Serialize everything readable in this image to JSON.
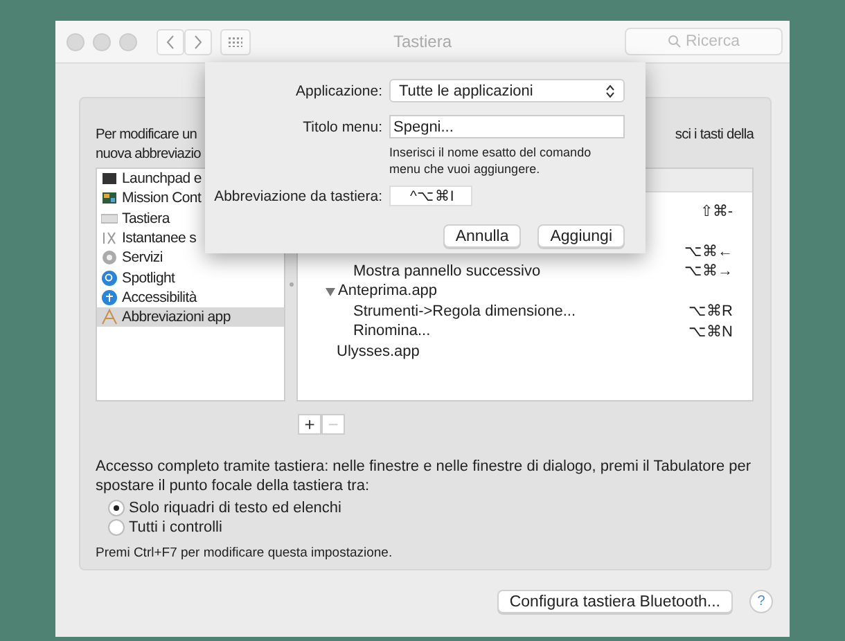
{
  "window": {
    "title": "Tastiera",
    "search": {
      "placeholder": "Ricerca"
    }
  },
  "intro": {
    "left_lines": [
      "Per modificare un",
      "nuova abbreviazio"
    ],
    "right_fragment": "sci i tasti della"
  },
  "sidebar": {
    "items": [
      {
        "label": "Launchpad e",
        "selected": false
      },
      {
        "label": "Mission Cont",
        "selected": false
      },
      {
        "label": "Tastiera",
        "selected": false
      },
      {
        "label": "Istantanee s",
        "selected": false
      },
      {
        "label": "Servizi",
        "selected": false
      },
      {
        "label": "Spotlight",
        "selected": false
      },
      {
        "label": "Accessibilità",
        "selected": false
      },
      {
        "label": "Abbreviazioni app",
        "selected": true
      }
    ]
  },
  "shortcuts": {
    "rows": [
      {
        "kind": "command",
        "shortcut": "⇧⌘-"
      },
      {
        "kind": "hidden"
      },
      {
        "kind": "command",
        "shortcut": "⌥⌘←"
      },
      {
        "kind": "command",
        "label": "Mostra pannello successivo",
        "shortcut": "⌥⌘→"
      },
      {
        "kind": "app",
        "label": "Anteprima.app",
        "expanded": true
      },
      {
        "kind": "command",
        "label": "Strumenti->Regola dimensione...",
        "shortcut": "⌥⌘R"
      },
      {
        "kind": "command",
        "label": "Rinomina...",
        "shortcut": "⌥⌘N"
      },
      {
        "kind": "app",
        "label": "Ulysses.app"
      }
    ],
    "buttons": [
      {
        "label": "+",
        "disabled": false
      },
      {
        "label": "−",
        "disabled": true
      }
    ]
  },
  "full_access": {
    "text": "Accesso completo tramite tastiera: nelle finestre e nelle finestre di dialogo, premi il Tabulatore per spostare il punto focale della tastiera tra:",
    "options": [
      {
        "label": "Solo riquadri di testo ed elenchi",
        "selected": true
      },
      {
        "label": "Tutti i controlli",
        "selected": false
      }
    ],
    "note": "Premi Ctrl+F7 per modificare questa impostazione."
  },
  "bluetooth_button": "Configura tastiera Bluetooth...",
  "help_button": "?",
  "sheet": {
    "application_label": "Applicazione:",
    "application_value": "Tutte le applicazioni",
    "menu_title_label": "Titolo menu:",
    "menu_title_value": "Spegni...",
    "hint": "Inserisci il nome esatto del comando menu che vuoi aggiungere.",
    "shortcut_label": "Abbreviazione da tastiera:",
    "shortcut_value": "^⌥⌘I",
    "buttons": [
      "Annulla",
      "Aggiungi"
    ]
  }
}
